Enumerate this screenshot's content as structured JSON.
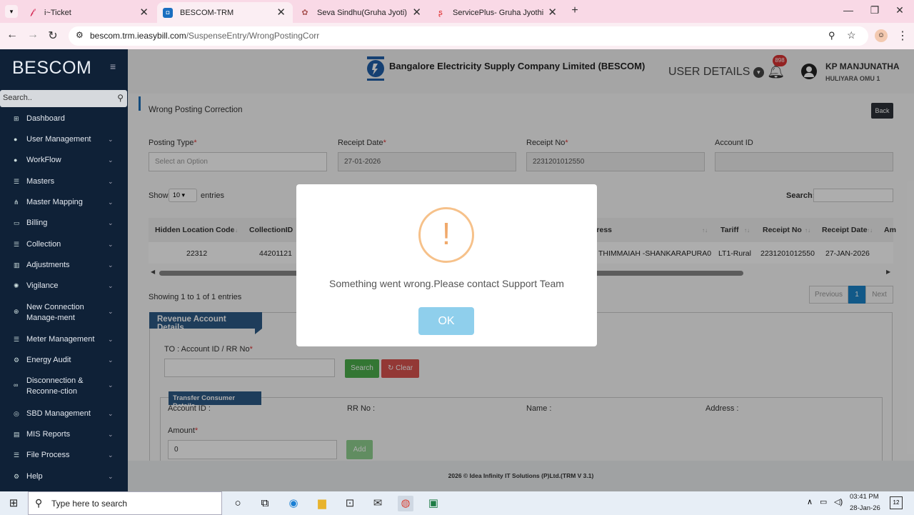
{
  "browser": {
    "tabs": [
      {
        "title": "i~Ticket",
        "icon": "ticket-icon"
      },
      {
        "title": "BESCOM-TRM",
        "icon": "bescom-icon",
        "active": true
      },
      {
        "title": "Seva Sindhu(Gruha Jyoti)",
        "icon": "emblem-icon"
      },
      {
        "title": "ServicePlus- Gruha Jyothi Schem",
        "icon": "serviceplus-icon"
      }
    ],
    "new_tab": "+",
    "url_host": "bescom.trm.ieasybill.com",
    "url_path": "/SuspenseEntry/WrongPostingCorr"
  },
  "sidebar": {
    "brand": "BESCOM",
    "search_placeholder": "Search..",
    "menu": [
      {
        "label": "Dashboard",
        "icon": "dashboard-icon",
        "has_children": false
      },
      {
        "label": "User Management",
        "icon": "user-icon",
        "has_children": true
      },
      {
        "label": "WorkFlow",
        "icon": "user-icon",
        "has_children": true
      },
      {
        "label": "Masters",
        "icon": "list-icon",
        "has_children": true
      },
      {
        "label": "Master Mapping",
        "icon": "sitemap-icon",
        "has_children": true
      },
      {
        "label": "Billing",
        "icon": "monitor-icon",
        "has_children": true
      },
      {
        "label": "Collection",
        "icon": "list-icon",
        "has_children": true
      },
      {
        "label": "Adjustments",
        "icon": "chart-icon",
        "has_children": true
      },
      {
        "label": "Vigilance",
        "icon": "vigilance-icon",
        "has_children": true
      },
      {
        "label": "New Connection Manage-ment",
        "icon": "plus-circle-icon",
        "has_children": true
      },
      {
        "label": "Meter Management",
        "icon": "list-icon",
        "has_children": true
      },
      {
        "label": "Energy Audit",
        "icon": "gears-icon",
        "has_children": true
      },
      {
        "label": "Disconnection & Reconne-ction",
        "icon": "link-icon",
        "has_children": true
      },
      {
        "label": "SBD Management",
        "icon": "database-icon",
        "has_children": true
      },
      {
        "label": "MIS Reports",
        "icon": "bar-chart-icon",
        "has_children": true
      },
      {
        "label": "File Process",
        "icon": "list-icon",
        "has_children": true
      },
      {
        "label": "Help",
        "icon": "gear-icon",
        "has_children": true
      }
    ]
  },
  "header": {
    "company": "Bangalore Electricity Supply Company Limited (BESCOM)",
    "user_details": "USER DETAILS",
    "notif_count": "898",
    "user_name": "KP MANJUNATHA",
    "user_location": "HULIYARA OMU 1"
  },
  "page": {
    "title": "Wrong Posting Correction",
    "back": "Back",
    "fields": {
      "posting_type_label": "Posting Type",
      "posting_type_placeholder": "Select an Option",
      "receipt_date_label": "Receipt Date",
      "receipt_date_value": "27-01-2026",
      "receipt_no_label": "Receipt No",
      "receipt_no_value": "2231201012550",
      "account_id_label": "Account ID",
      "account_id_value": ""
    },
    "table_controls": {
      "show": "Show",
      "page_size": "10",
      "entries": "entries",
      "search": "Search:"
    },
    "table": {
      "columns": [
        "Hidden Location Code",
        "CollectionID",
        "dress",
        "Tariff",
        "Receipt No",
        "Receipt Date",
        "Am"
      ],
      "rows": [
        [
          "22312",
          "44201121",
          "THIMMAIAH -SHANKARAPURA0",
          "LT1-Rural",
          "2231201012550",
          "27-JAN-2026",
          ""
        ]
      ]
    },
    "info": "Showing 1 to 1 of 1 entries",
    "pagination": {
      "previous": "Previous",
      "current": "1",
      "next": "Next"
    },
    "revenue": {
      "title": "Revenue Account Details",
      "to_label": "TO : Account ID / RR No",
      "search_btn": "Search",
      "clear_btn": "Clear",
      "transfer_title": "Transfer Consumer Details",
      "account_id": "Account ID :",
      "rr_no": "RR No :",
      "name": "Name :",
      "address": "Address :",
      "amount_label": "Amount",
      "amount_value": "0",
      "add_btn": "Add"
    },
    "footer": "2026 © Idea Infinity IT Solutions (P)Ltd.(TRM V 3.1)"
  },
  "modal": {
    "message": "Something went wrong.Please contact Support Team",
    "ok": "OK"
  },
  "taskbar": {
    "search_placeholder": "Type here to search",
    "time": "03:41 PM",
    "date": "28-Jan-26",
    "notifications": "12"
  }
}
